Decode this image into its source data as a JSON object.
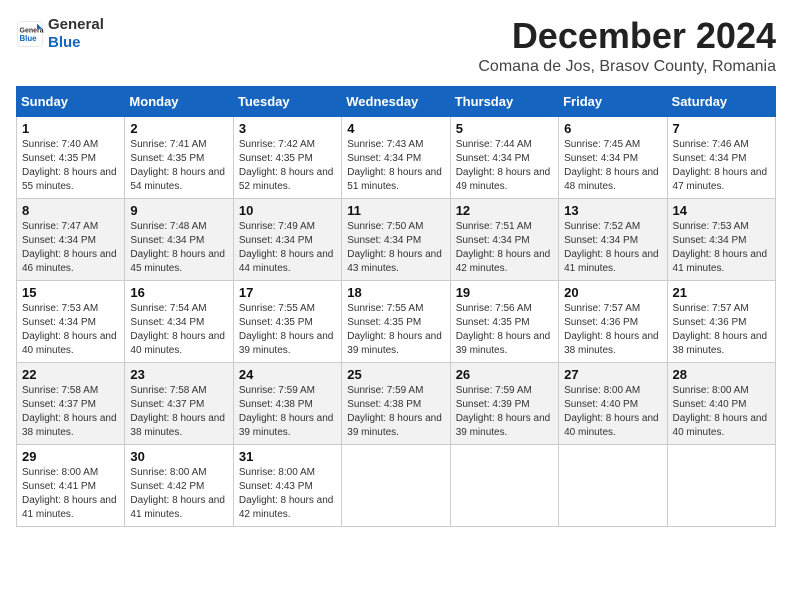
{
  "header": {
    "logo_line1": "General",
    "logo_line2": "Blue",
    "month": "December 2024",
    "location": "Comana de Jos, Brasov County, Romania"
  },
  "weekdays": [
    "Sunday",
    "Monday",
    "Tuesday",
    "Wednesday",
    "Thursday",
    "Friday",
    "Saturday"
  ],
  "weeks": [
    [
      {
        "day": "1",
        "sunrise": "7:40 AM",
        "sunset": "4:35 PM",
        "daylight": "8 hours and 55 minutes."
      },
      {
        "day": "2",
        "sunrise": "7:41 AM",
        "sunset": "4:35 PM",
        "daylight": "8 hours and 54 minutes."
      },
      {
        "day": "3",
        "sunrise": "7:42 AM",
        "sunset": "4:35 PM",
        "daylight": "8 hours and 52 minutes."
      },
      {
        "day": "4",
        "sunrise": "7:43 AM",
        "sunset": "4:34 PM",
        "daylight": "8 hours and 51 minutes."
      },
      {
        "day": "5",
        "sunrise": "7:44 AM",
        "sunset": "4:34 PM",
        "daylight": "8 hours and 49 minutes."
      },
      {
        "day": "6",
        "sunrise": "7:45 AM",
        "sunset": "4:34 PM",
        "daylight": "8 hours and 48 minutes."
      },
      {
        "day": "7",
        "sunrise": "7:46 AM",
        "sunset": "4:34 PM",
        "daylight": "8 hours and 47 minutes."
      }
    ],
    [
      {
        "day": "8",
        "sunrise": "7:47 AM",
        "sunset": "4:34 PM",
        "daylight": "8 hours and 46 minutes."
      },
      {
        "day": "9",
        "sunrise": "7:48 AM",
        "sunset": "4:34 PM",
        "daylight": "8 hours and 45 minutes."
      },
      {
        "day": "10",
        "sunrise": "7:49 AM",
        "sunset": "4:34 PM",
        "daylight": "8 hours and 44 minutes."
      },
      {
        "day": "11",
        "sunrise": "7:50 AM",
        "sunset": "4:34 PM",
        "daylight": "8 hours and 43 minutes."
      },
      {
        "day": "12",
        "sunrise": "7:51 AM",
        "sunset": "4:34 PM",
        "daylight": "8 hours and 42 minutes."
      },
      {
        "day": "13",
        "sunrise": "7:52 AM",
        "sunset": "4:34 PM",
        "daylight": "8 hours and 41 minutes."
      },
      {
        "day": "14",
        "sunrise": "7:53 AM",
        "sunset": "4:34 PM",
        "daylight": "8 hours and 41 minutes."
      }
    ],
    [
      {
        "day": "15",
        "sunrise": "7:53 AM",
        "sunset": "4:34 PM",
        "daylight": "8 hours and 40 minutes."
      },
      {
        "day": "16",
        "sunrise": "7:54 AM",
        "sunset": "4:34 PM",
        "daylight": "8 hours and 40 minutes."
      },
      {
        "day": "17",
        "sunrise": "7:55 AM",
        "sunset": "4:35 PM",
        "daylight": "8 hours and 39 minutes."
      },
      {
        "day": "18",
        "sunrise": "7:55 AM",
        "sunset": "4:35 PM",
        "daylight": "8 hours and 39 minutes."
      },
      {
        "day": "19",
        "sunrise": "7:56 AM",
        "sunset": "4:35 PM",
        "daylight": "8 hours and 39 minutes."
      },
      {
        "day": "20",
        "sunrise": "7:57 AM",
        "sunset": "4:36 PM",
        "daylight": "8 hours and 38 minutes."
      },
      {
        "day": "21",
        "sunrise": "7:57 AM",
        "sunset": "4:36 PM",
        "daylight": "8 hours and 38 minutes."
      }
    ],
    [
      {
        "day": "22",
        "sunrise": "7:58 AM",
        "sunset": "4:37 PM",
        "daylight": "8 hours and 38 minutes."
      },
      {
        "day": "23",
        "sunrise": "7:58 AM",
        "sunset": "4:37 PM",
        "daylight": "8 hours and 38 minutes."
      },
      {
        "day": "24",
        "sunrise": "7:59 AM",
        "sunset": "4:38 PM",
        "daylight": "8 hours and 39 minutes."
      },
      {
        "day": "25",
        "sunrise": "7:59 AM",
        "sunset": "4:38 PM",
        "daylight": "8 hours and 39 minutes."
      },
      {
        "day": "26",
        "sunrise": "7:59 AM",
        "sunset": "4:39 PM",
        "daylight": "8 hours and 39 minutes."
      },
      {
        "day": "27",
        "sunrise": "8:00 AM",
        "sunset": "4:40 PM",
        "daylight": "8 hours and 40 minutes."
      },
      {
        "day": "28",
        "sunrise": "8:00 AM",
        "sunset": "4:40 PM",
        "daylight": "8 hours and 40 minutes."
      }
    ],
    [
      {
        "day": "29",
        "sunrise": "8:00 AM",
        "sunset": "4:41 PM",
        "daylight": "8 hours and 41 minutes."
      },
      {
        "day": "30",
        "sunrise": "8:00 AM",
        "sunset": "4:42 PM",
        "daylight": "8 hours and 41 minutes."
      },
      {
        "day": "31",
        "sunrise": "8:00 AM",
        "sunset": "4:43 PM",
        "daylight": "8 hours and 42 minutes."
      },
      null,
      null,
      null,
      null
    ]
  ],
  "labels": {
    "sunrise": "Sunrise:",
    "sunset": "Sunset:",
    "daylight": "Daylight:"
  }
}
